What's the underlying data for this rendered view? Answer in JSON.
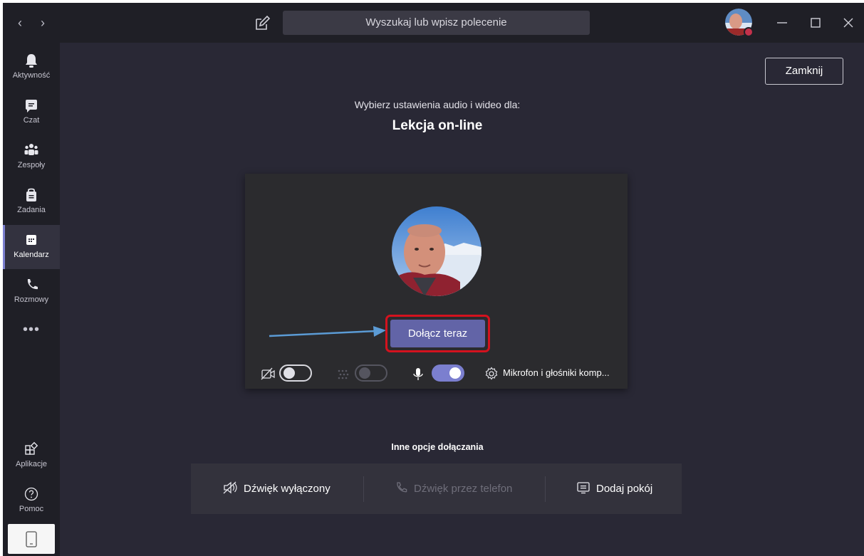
{
  "titlebar": {
    "back_icon": "chevron-left-icon",
    "forward_icon": "chevron-right-icon",
    "compose_icon": "compose-icon",
    "search_placeholder": "Wyszukaj lub wpisz polecenie",
    "presence_color": "#c4314b"
  },
  "rail": {
    "items": [
      {
        "label": "Aktywność",
        "icon": "bell-icon"
      },
      {
        "label": "Czat",
        "icon": "chat-icon"
      },
      {
        "label": "Zespoły",
        "icon": "teams-icon"
      },
      {
        "label": "Zadania",
        "icon": "assignments-icon"
      },
      {
        "label": "Kalendarz",
        "icon": "calendar-icon",
        "active": true
      },
      {
        "label": "Rozmowy",
        "icon": "phone-icon"
      }
    ],
    "more_label": "•••",
    "apps_label": "Aplikacje",
    "help_label": "Pomoc"
  },
  "main": {
    "close_label": "Zamknij",
    "subtitle": "Wybierz ustawienia audio i wideo dla:",
    "meeting_title": "Lekcja on-line",
    "join_label": "Dołącz teraz",
    "device_label": "Mikrofon i głośniki komp...",
    "camera_on": false,
    "blur_on": false,
    "mic_on": true,
    "accent_color": "#6264a7",
    "highlight_color": "#d4121e",
    "arrow_color": "#5b9bd5"
  },
  "other_options": {
    "title": "Inne opcje dołączania",
    "audio_off_label": "Dźwięk wyłączony",
    "phone_audio_label": "Dźwięk przez telefon",
    "add_room_label": "Dodaj pokój"
  }
}
